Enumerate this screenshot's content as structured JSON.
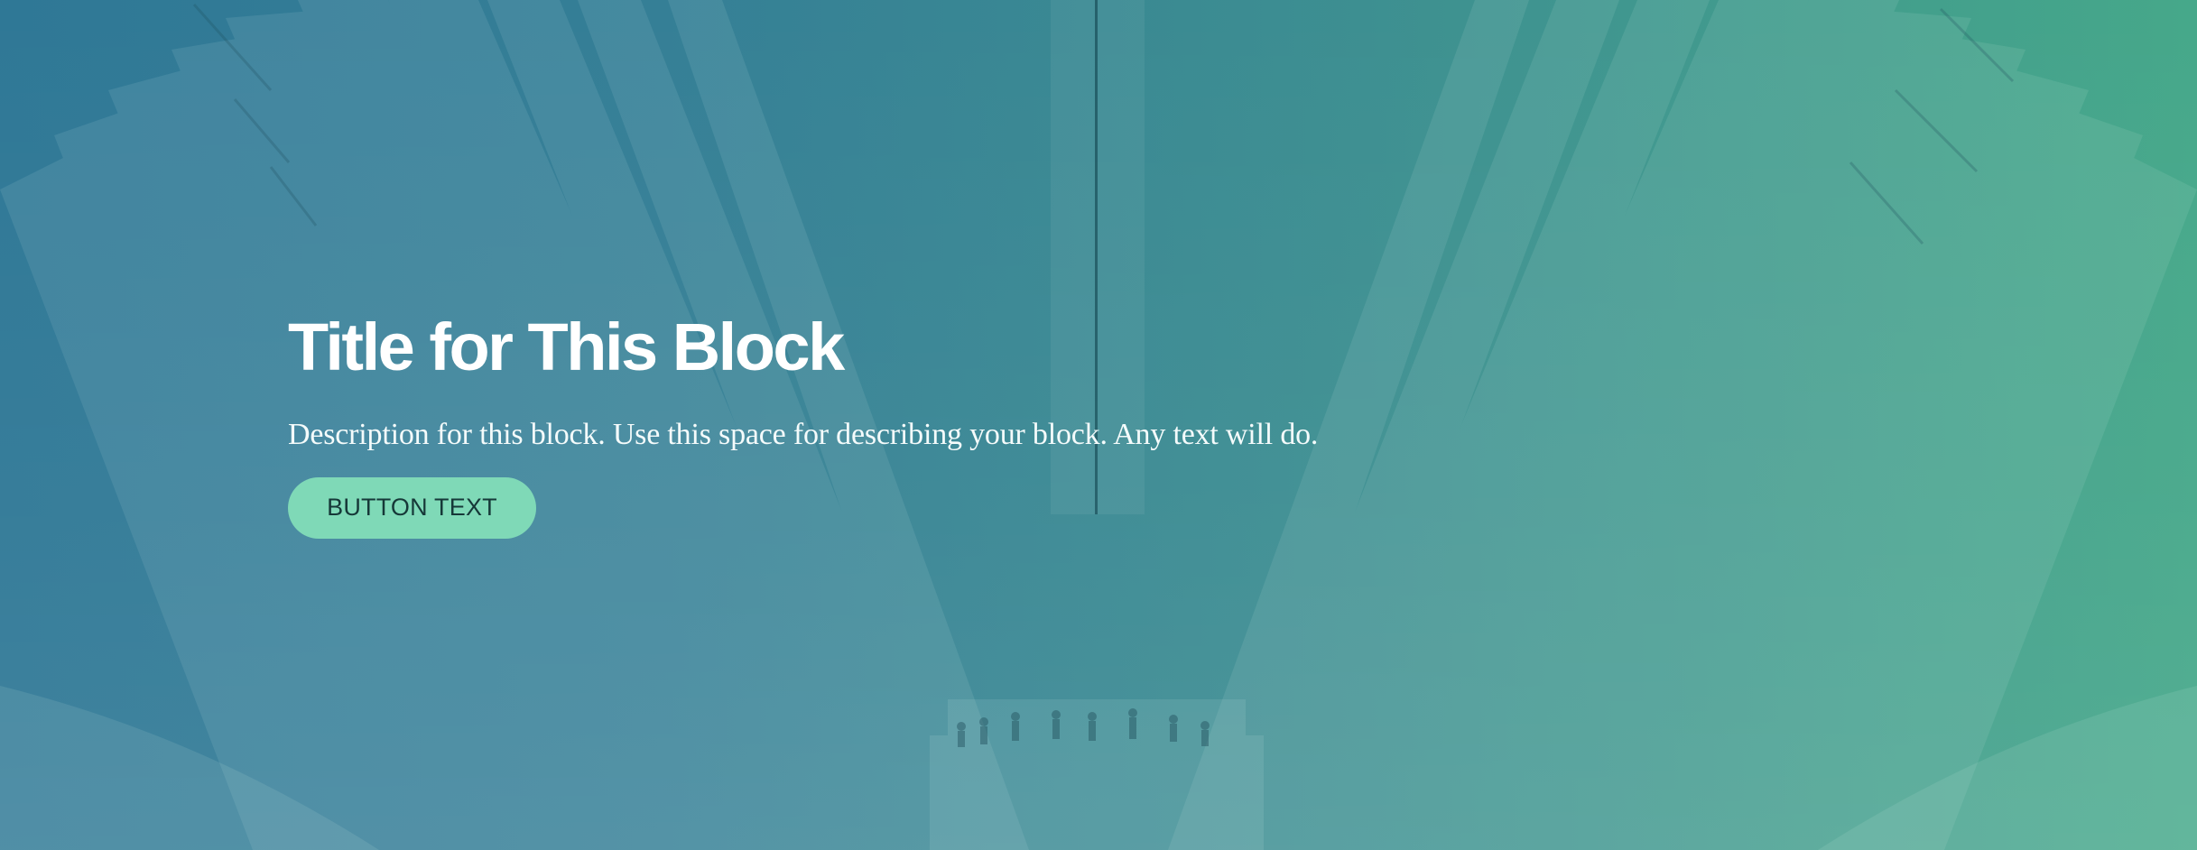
{
  "hero": {
    "title": "Title for This Block",
    "description": "Description for this block. Use this space for describing your block. Any text will do.",
    "button_text": "BUTTON TEXT"
  },
  "colors": {
    "gradient_left": "#2f7896",
    "gradient_right": "#46a88a",
    "title_text": "#ffffff",
    "description_text": "#f4fbfb",
    "button_background": "#7fd9b7",
    "button_text": "#163838"
  }
}
